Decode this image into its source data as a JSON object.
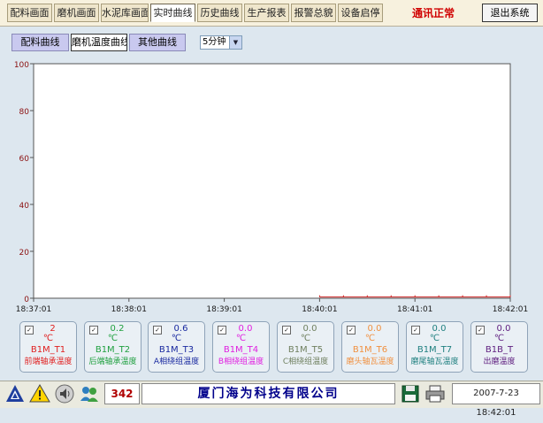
{
  "nav": {
    "items": [
      {
        "label": "配料画面"
      },
      {
        "label": "磨机画面"
      },
      {
        "label": "水泥库画面"
      },
      {
        "label": "实时曲线",
        "active": true
      },
      {
        "label": "历史曲线"
      },
      {
        "label": "生产报表"
      },
      {
        "label": "报警总貌"
      },
      {
        "label": "设备启停"
      }
    ],
    "status_text": "通讯正常",
    "exit_label": "退出系统"
  },
  "subtabs": [
    {
      "label": "配料曲线"
    },
    {
      "label": "磨机温度曲线",
      "active": true
    },
    {
      "label": "其他曲线"
    }
  ],
  "interval": {
    "selected": "5分钟"
  },
  "chart_data": {
    "type": "line",
    "y_ticks": [
      "100",
      "80",
      "60",
      "40",
      "20",
      "0"
    ],
    "ylim": [
      0,
      100
    ],
    "x_ticks": [
      "18:37:01",
      "18:38:01",
      "18:39:01",
      "18:40:01",
      "18:41:01",
      "18:42:01"
    ],
    "series": [
      {
        "color": "#cc2020",
        "x": [
          "18:40:01",
          "18:42:01"
        ],
        "values": [
          0.5,
          0.5
        ]
      }
    ]
  },
  "sensors": [
    {
      "value": "2",
      "unit": "℃",
      "code": "B1M_T1",
      "desc": "前端轴承温度",
      "color": "#e02020"
    },
    {
      "value": "0.2",
      "unit": "℃",
      "code": "B1M_T2",
      "desc": "后端轴承温度",
      "color": "#20a040"
    },
    {
      "value": "0.6",
      "unit": "℃",
      "code": "B1M_T3",
      "desc": "A相绕组温度",
      "color": "#1a2aa0"
    },
    {
      "value": "0.0",
      "unit": "℃",
      "code": "B1M_T4",
      "desc": "B相绕组温度",
      "color": "#e020e0"
    },
    {
      "value": "0.0",
      "unit": "℃",
      "code": "B1M_T5",
      "desc": "C相绕组温度",
      "color": "#708060"
    },
    {
      "value": "0.0",
      "unit": "℃",
      "code": "B1M_T6",
      "desc": "磨头轴瓦温度",
      "color": "#f09040"
    },
    {
      "value": "0.0",
      "unit": "℃",
      "code": "B1M_T7",
      "desc": "磨尾轴瓦温度",
      "color": "#208080"
    },
    {
      "value": "0.0",
      "unit": "℃",
      "code": "B1B_T",
      "desc": "出磨温度",
      "color": "#602080"
    }
  ],
  "footer": {
    "count": "342",
    "company": "厦门海为科技有限公司",
    "datetime": "2007-7-23 18:42:01"
  },
  "colors": {
    "accent_red": "#d00000",
    "company_blue": "#00008b"
  }
}
